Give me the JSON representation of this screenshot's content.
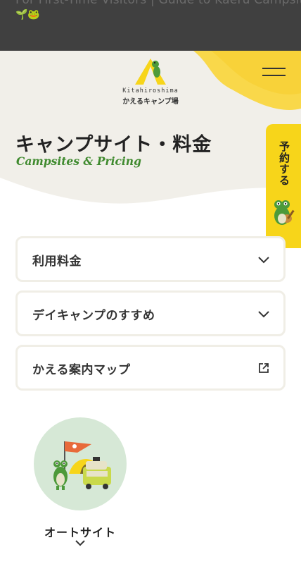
{
  "top_bar": {
    "text": "For First-Time Visitors | Guide to Kaeru Campsite",
    "emoji": "🌱🐸"
  },
  "logo": {
    "roman": "Kitahiroshima",
    "japanese": "かえるキャンプ場"
  },
  "header": {
    "title": "キャンプサイト・料金",
    "subtitle": "Campsites & Pricing"
  },
  "reserve_tab": {
    "label": "予約する"
  },
  "accordions": [
    {
      "label": "利用料金",
      "icon": "chevron-down-icon"
    },
    {
      "label": "デイキャンプのすすめ",
      "icon": "chevron-down-icon"
    },
    {
      "label": "かえる案内マップ",
      "icon": "external-link-icon"
    }
  ],
  "site_card": {
    "label": "オートサイト",
    "icon": "chevron-down-icon"
  },
  "colors": {
    "accent_yellow": "#f7d51a",
    "subtitle_green": "#3f8a2e",
    "hero_bg": "#f1efe9",
    "top_bar": "#404040",
    "card_circle": "#d6e8d6"
  }
}
